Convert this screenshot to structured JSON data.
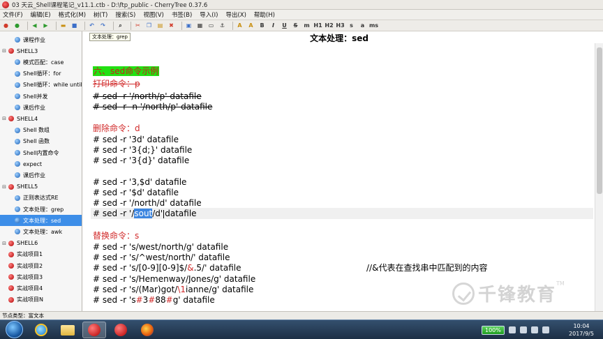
{
  "window": {
    "title": "03 天云_Shell课程笔记_v11.1.ctb - D:\\ftp_public - CherryTree 0.37.6"
  },
  "menu": [
    "文件(F)",
    "编辑(E)",
    "格式化(M)",
    "树(T)",
    "搜索(S)",
    "视图(V)",
    "书签(B)",
    "导入(I)",
    "导出(X)",
    "帮助(H)"
  ],
  "toolbar": {
    "text_buttons": [
      "H1",
      "H2",
      "H3",
      "s",
      "a",
      "ms"
    ]
  },
  "tree": [
    {
      "label": "课程作业",
      "level": 2,
      "bullet": "blue"
    },
    {
      "label": "SHELL3",
      "level": 1,
      "bullet": "red",
      "expander": "⊟"
    },
    {
      "label": "模式匹配：case",
      "level": 2,
      "bullet": "blue"
    },
    {
      "label": "Shell循环：for",
      "level": 2,
      "bullet": "blue"
    },
    {
      "label": "Shell循环：while until",
      "level": 2,
      "bullet": "blue"
    },
    {
      "label": "Shell并发",
      "level": 2,
      "bullet": "blue"
    },
    {
      "label": "课后作业",
      "level": 2,
      "bullet": "blue"
    },
    {
      "label": "SHELL4",
      "level": 1,
      "bullet": "red",
      "expander": "⊟"
    },
    {
      "label": "Shell 数组",
      "level": 2,
      "bullet": "blue"
    },
    {
      "label": "Shell 函数",
      "level": 2,
      "bullet": "blue"
    },
    {
      "label": "Shell内置命令",
      "level": 2,
      "bullet": "blue"
    },
    {
      "label": "expect",
      "level": 2,
      "bullet": "blue"
    },
    {
      "label": "课后作业",
      "level": 2,
      "bullet": "blue"
    },
    {
      "label": "SHELL5",
      "level": 1,
      "bullet": "red",
      "expander": "⊟"
    },
    {
      "label": "正则表达式RE",
      "level": 2,
      "bullet": "blue"
    },
    {
      "label": "文本处理：grep",
      "level": 2,
      "bullet": "blue"
    },
    {
      "label": "文本处理：sed",
      "level": 2,
      "bullet": "blue",
      "selected": true
    },
    {
      "label": "文本处理：awk",
      "level": 2,
      "bullet": "blue"
    },
    {
      "label": "SHELL6",
      "level": 1,
      "bullet": "red",
      "expander": "⊟"
    },
    {
      "label": "实战项目1",
      "level": 1,
      "bullet": "red"
    },
    {
      "label": "实战项目2",
      "level": 1,
      "bullet": "red"
    },
    {
      "label": "实战项目3",
      "level": 1,
      "bullet": "red"
    },
    {
      "label": "实战项目4",
      "level": 1,
      "bullet": "red"
    },
    {
      "label": "实战项目N",
      "level": 1,
      "bullet": "red"
    }
  ],
  "tab_hint": "文本处理：grep",
  "node_title": "文本处理：sed",
  "editor": {
    "section_heading": "六、sed命令示例",
    "print_heading": "打印命令：p",
    "print_lines": [
      "# sed -r '/north/p' datafile",
      "# sed -r -n '/north/p' datafile"
    ],
    "delete_heading": "删除命令：d",
    "delete_lines": [
      "# sed -r '3d' datafile",
      "# sed -r '3{d;}' datafile",
      "# sed -r '3{d}' datafile",
      "# sed -r '3,$d' datafile",
      "# sed -r '$d' datafile",
      "# sed -r '/north/d' datafile"
    ],
    "selected_line": {
      "prefix": "# sed -r '/",
      "selected": "sout",
      "middle": "/d'",
      "suffix": "datafile"
    },
    "replace_heading": "替换命令：s",
    "replace_lines": [
      {
        "text": "# sed -r 's/west/north/g' datafile"
      },
      {
        "text": "# sed -r 's/^west/north/' datafile"
      },
      {
        "pre": "# sed -r 's/[0-9][0-9]$/",
        "red": "&",
        "post": ".5/' datafile",
        "comment": "//&代表在查找串中匹配到的内容"
      },
      {
        "text": "# sed -r 's/Hemenway/Jones/g' datafile"
      },
      {
        "pre": "# sed -r 's/(Mar)got/",
        "red": "\\1",
        "post": "ianne/g' datafile"
      },
      {
        "pre": "# sed -r 's",
        "red": "#",
        "mid": "3",
        "red2": "#",
        "mid2": "88",
        "red3": "#",
        "post": "g' datafile"
      }
    ]
  },
  "status_bar": "节点类型：富文本",
  "watermark": {
    "text": "千锋教育",
    "tm": "TM"
  },
  "taskbar": {
    "battery": "100%",
    "clock_time": "10:04",
    "clock_date": "2017/9/5"
  },
  "colors": {
    "selection": "#3d8ee8",
    "heading_red": "#d12a2a",
    "heading_bg_green": "#22e012"
  }
}
